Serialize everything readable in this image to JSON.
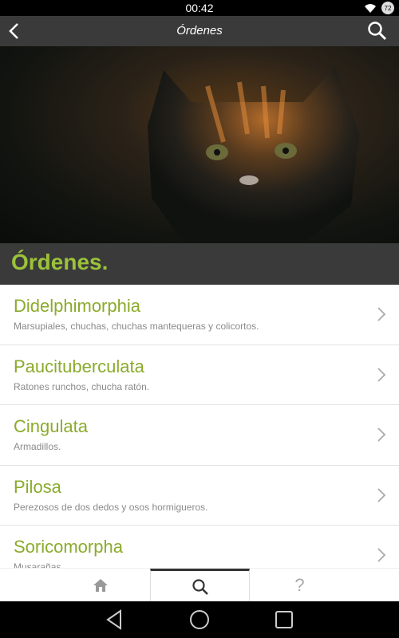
{
  "status_bar": {
    "time": "00:42",
    "battery_level": "72"
  },
  "toolbar": {
    "title": "Órdenes",
    "back_icon": "back-arrow-icon",
    "search_icon": "search-icon"
  },
  "hero": {
    "alt": "wild cat photo"
  },
  "section": {
    "title": "Órdenes."
  },
  "orders": [
    {
      "name": "Didelphimorphia",
      "desc": "Marsupiales, chuchas, chuchas mantequeras y colicortos."
    },
    {
      "name": "Paucituberculata",
      "desc": "Ratones runchos, chucha ratón."
    },
    {
      "name": "Cingulata",
      "desc": "Armadillos."
    },
    {
      "name": "Pilosa",
      "desc": "Perezosos de dos dedos y osos hormigueros."
    },
    {
      "name": "Soricomorpha",
      "desc": "Musarañas"
    }
  ],
  "bottom_nav": {
    "help_label": "?"
  },
  "colors": {
    "accent": "#8aab2b",
    "toolbar_bg": "#3a3a3a"
  }
}
